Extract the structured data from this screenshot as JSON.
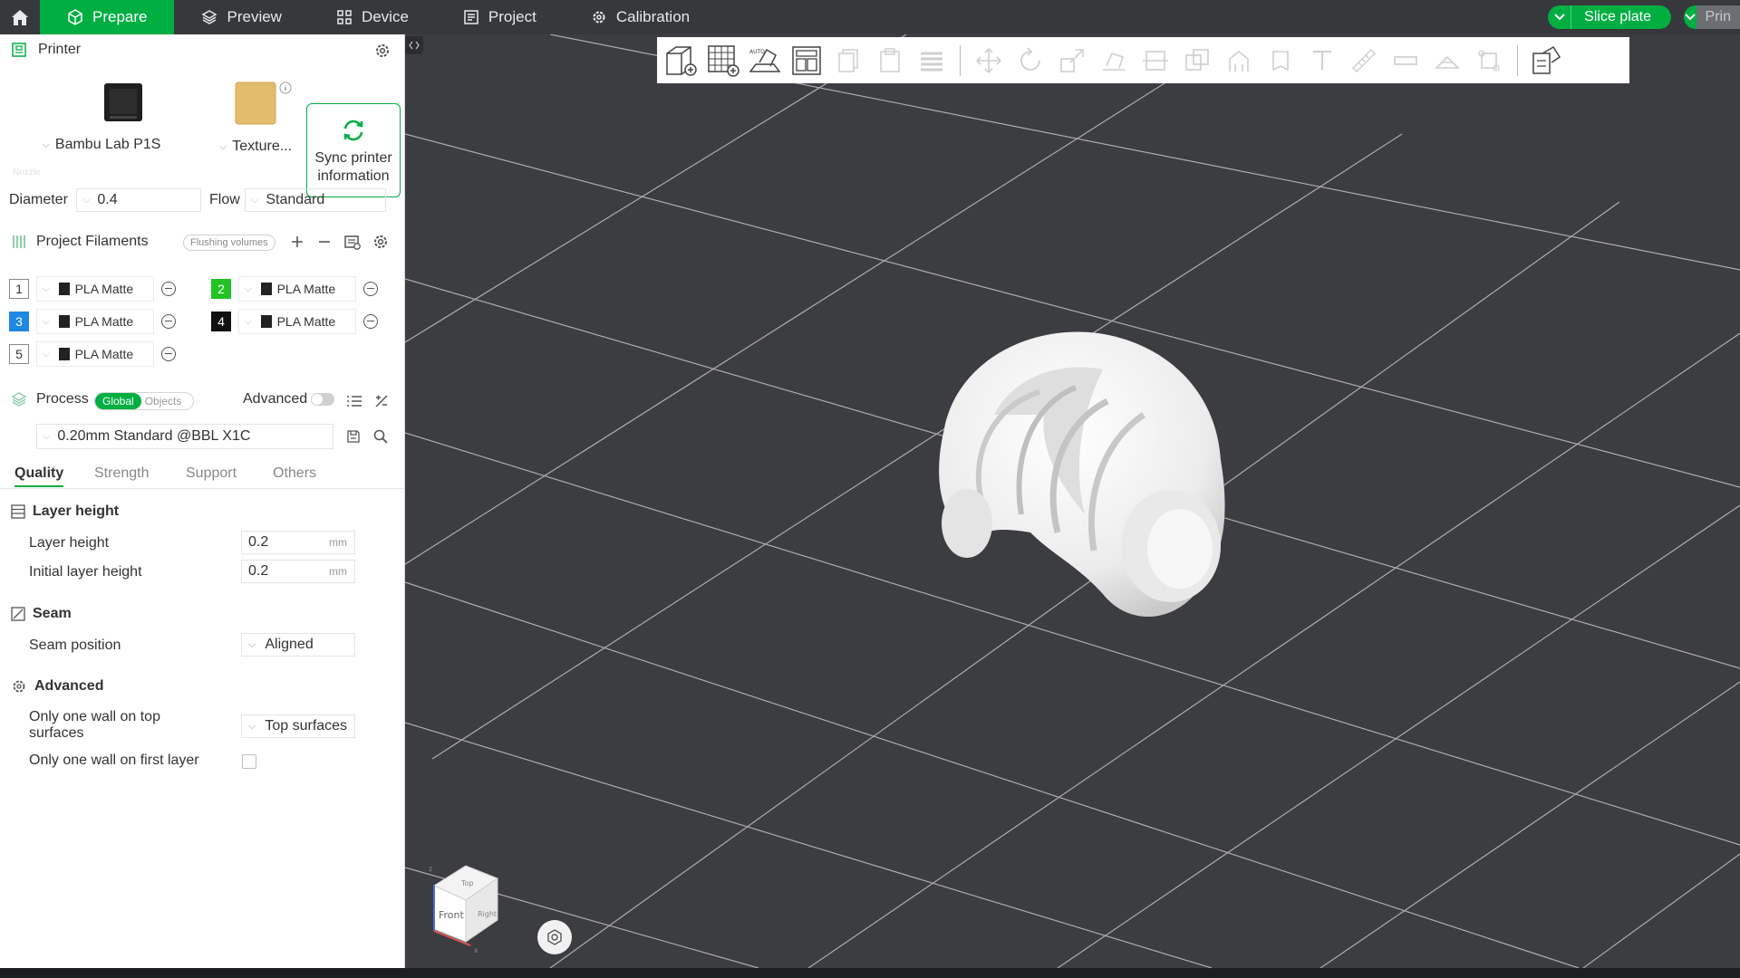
{
  "topbar": {
    "tabs": [
      {
        "label": "Prepare",
        "icon": "cube-icon"
      },
      {
        "label": "Preview",
        "icon": "layers-icon"
      },
      {
        "label": "Device",
        "icon": "device-icon"
      },
      {
        "label": "Project",
        "icon": "project-icon"
      },
      {
        "label": "Calibration",
        "icon": "gear-icon"
      }
    ],
    "active_tab": "Prepare",
    "slice_label": "Slice plate",
    "print_label": "Prin"
  },
  "printer": {
    "title": "Printer",
    "model": "Bambu Lab P1S",
    "plate": "Texture...",
    "sync_label_1": "Sync printer",
    "sync_label_2": "information",
    "nozzle_caption": "Nozzle",
    "diameter_label": "Diameter",
    "diameter_value": "0.4",
    "flow_label": "Flow",
    "flow_value": "Standard"
  },
  "filaments": {
    "title": "Project Filaments",
    "flushing_label": "Flushing volumes",
    "items": [
      {
        "num": "1",
        "name": "PLA Matte",
        "color": "#ffffff"
      },
      {
        "num": "2",
        "name": "PLA Matte",
        "color": "#22c322"
      },
      {
        "num": "3",
        "name": "PLA Matte",
        "color": "#1e88e5"
      },
      {
        "num": "4",
        "name": "PLA Matte",
        "color": "#111111"
      },
      {
        "num": "5",
        "name": "PLA Matte",
        "color": "#ffffff"
      }
    ]
  },
  "process": {
    "title": "Process",
    "scope_global": "Global",
    "scope_objects": "Objects",
    "advanced_label": "Advanced",
    "preset": "0.20mm Standard @BBL X1C",
    "tabs": [
      "Quality",
      "Strength",
      "Support",
      "Others"
    ],
    "active_tab": "Quality",
    "layer_height_group": "Layer height",
    "layer_height_label": "Layer height",
    "layer_height_value": "0.2",
    "initial_layer_label": "Initial layer height",
    "initial_layer_value": "0.2",
    "unit": "mm",
    "seam_group": "Seam",
    "seam_position_label": "Seam position",
    "seam_position_value": "Aligned",
    "advanced_group": "Advanced",
    "one_wall_top_label_1": "Only one wall on top",
    "one_wall_top_label_2": "surfaces",
    "one_wall_top_value": "Top surfaces",
    "one_wall_first_label": "Only one wall on first layer",
    "one_wall_first_checked": false
  },
  "viewcube": {
    "top": "Top",
    "front": "Front",
    "right": "Right",
    "axis_z": "z",
    "axis_x": "x"
  },
  "colors": {
    "accent": "#00ae42",
    "topbar": "#36383c",
    "viewport_bg": "#3c3d40",
    "grid_line": "#c9c9c9"
  }
}
